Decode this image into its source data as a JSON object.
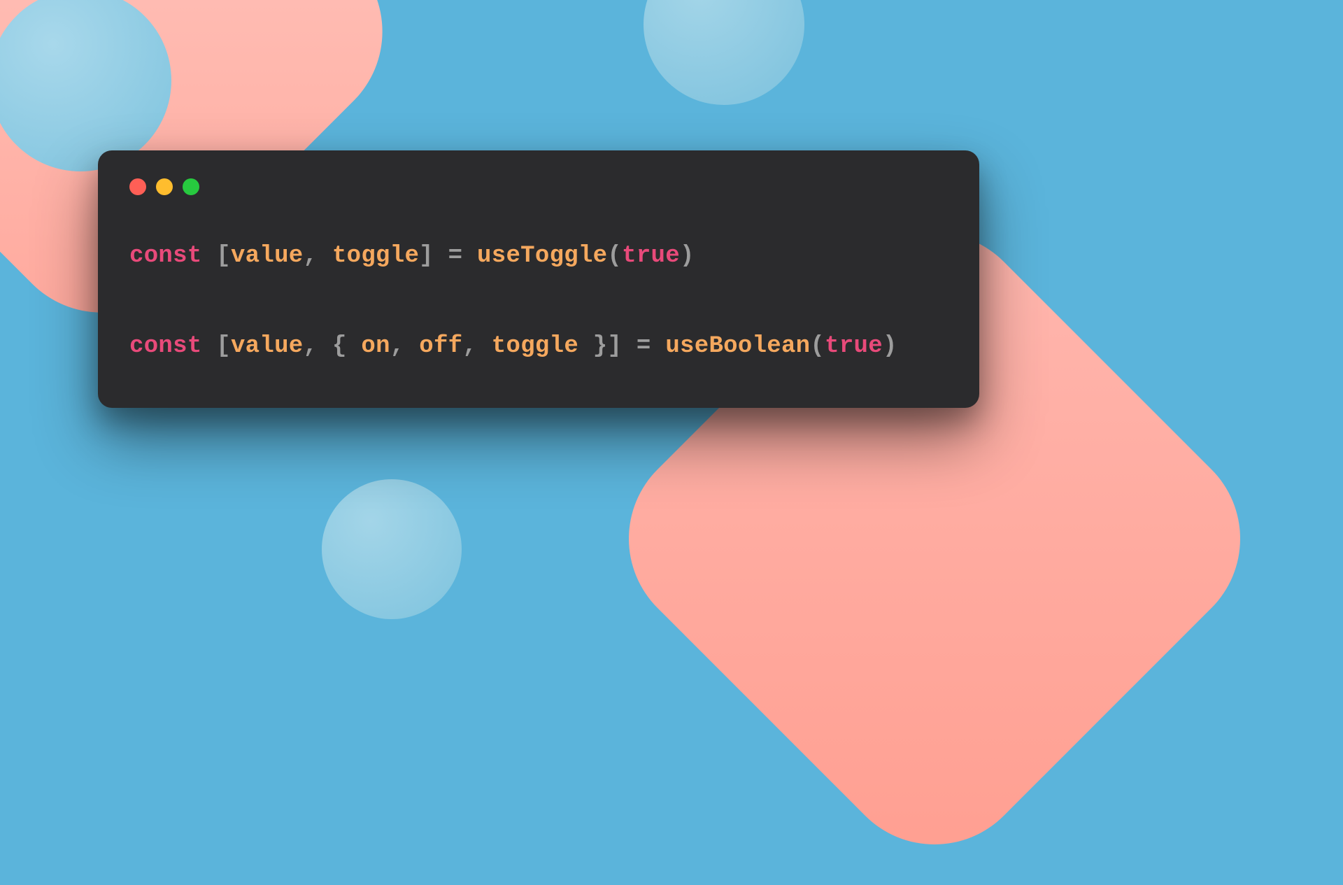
{
  "colors": {
    "background": "#5bb4db",
    "window_bg": "#2b2b2d",
    "dot_red": "#ff5f56",
    "dot_yellow": "#ffbd2e",
    "dot_green": "#27c93f",
    "keyword": "#e84a7a",
    "variable": "#f5a85e",
    "punctuation": "#9d9d9d"
  },
  "code": {
    "line1": {
      "keyword": "const",
      "sp1": " ",
      "lbracket": "[",
      "var1": "value",
      "comma1": ",",
      "sp2": " ",
      "var2": "toggle",
      "rbracket": "]",
      "sp3": " ",
      "eq": "=",
      "sp4": " ",
      "func": "useToggle",
      "lparen": "(",
      "arg": "true",
      "rparen": ")"
    },
    "line2": {
      "keyword": "const",
      "sp1": " ",
      "lbracket": "[",
      "var1": "value",
      "comma1": ",",
      "sp2": " ",
      "lbrace": "{",
      "sp3": " ",
      "var2": "on",
      "comma2": ",",
      "sp4": " ",
      "var3": "off",
      "comma3": ",",
      "sp5": " ",
      "var4": "toggle",
      "sp6": " ",
      "rbrace": "}",
      "rbracket": "]",
      "sp7": " ",
      "eq": "=",
      "sp8": " ",
      "func": "useBoolean",
      "lparen": "(",
      "arg": "true",
      "rparen": ")"
    }
  }
}
